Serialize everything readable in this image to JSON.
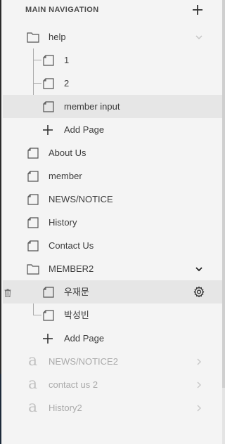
{
  "header": {
    "title": "MAIN NAVIGATION",
    "add_icon": "plus-icon"
  },
  "nav": {
    "help": {
      "label": "help",
      "expanded": true,
      "children": [
        {
          "label": "1"
        },
        {
          "label": "2"
        },
        {
          "label": "member input",
          "highlighted": true
        }
      ],
      "add_page": "Add Page"
    },
    "about_us": "About Us",
    "member": "member",
    "news_notice": "NEWS/NOTICE",
    "history": "History",
    "contact_us": "Contact Us",
    "member2": {
      "label": "MEMBER2",
      "expanded": true,
      "children": [
        {
          "label": "우재문",
          "highlighted": true
        },
        {
          "label": "박성빈"
        }
      ],
      "add_page": "Add Page"
    },
    "links": [
      {
        "label": "NEWS/NOTICE2"
      },
      {
        "label": "contact us 2"
      },
      {
        "label": "History2"
      }
    ]
  },
  "colors": {
    "background": "#f4f4f4",
    "highlight": "#e6e6e6",
    "text": "#3c3c3c",
    "muted": "#aaaaaa"
  },
  "icons": {
    "folder": "folder-icon",
    "page": "page-icon",
    "link": "link-page-icon",
    "gear": "gear-icon",
    "trash": "trash-icon",
    "chevron": "chevron-icon"
  }
}
